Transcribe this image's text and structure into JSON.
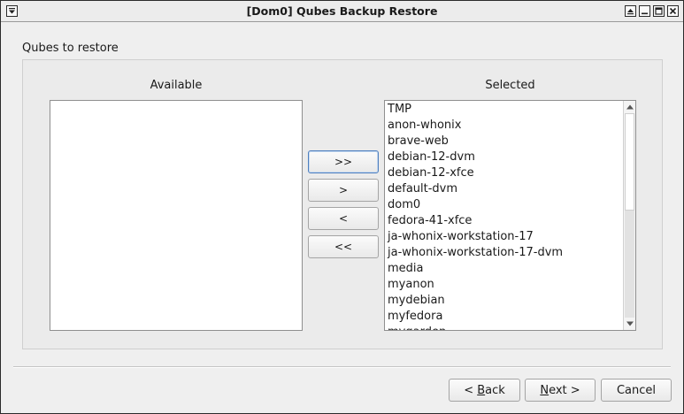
{
  "window": {
    "title": "[Dom0] Qubes Backup Restore"
  },
  "group": {
    "title": "Qubes to restore"
  },
  "available": {
    "label": "Available",
    "items": []
  },
  "selected": {
    "label": "Selected",
    "items": [
      "TMP",
      "anon-whonix",
      "brave-web",
      "debian-12-dvm",
      "debian-12-xfce",
      "default-dvm",
      "dom0",
      "fedora-41-xfce",
      "ja-whonix-workstation-17",
      "ja-whonix-workstation-17-dvm",
      "media",
      "myanon",
      "mydebian",
      "myfedora",
      "mygarden"
    ]
  },
  "move_buttons": {
    "add_all": ">>",
    "add_one": ">",
    "remove_one": "<",
    "remove_all": "<<"
  },
  "footer": {
    "back_mnemonic": "B",
    "back_rest": "ack",
    "back_prefix": "< ",
    "next_mnemonic": "N",
    "next_rest": "ext >",
    "cancel": "Cancel"
  }
}
